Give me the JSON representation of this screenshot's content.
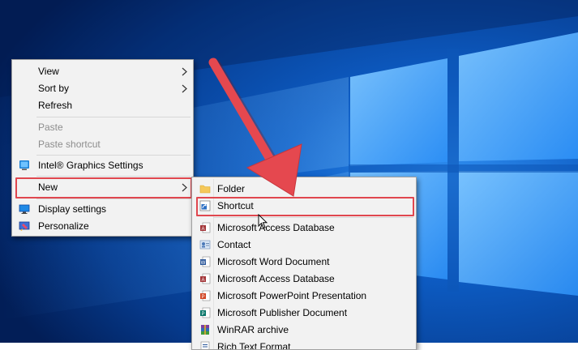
{
  "context_menu": {
    "items": [
      {
        "label": "View",
        "has_submenu": true
      },
      {
        "label": "Sort by",
        "has_submenu": true
      },
      {
        "label": "Refresh"
      },
      {
        "label": "Paste",
        "disabled": true
      },
      {
        "label": "Paste shortcut",
        "disabled": true
      },
      {
        "label": "Intel® Graphics Settings",
        "icon": "intel-graphics-icon"
      },
      {
        "label": "New",
        "has_submenu": true,
        "highlighted": true
      },
      {
        "label": "Display settings",
        "icon": "display-settings-icon"
      },
      {
        "label": "Personalize",
        "icon": "personalize-icon"
      }
    ]
  },
  "new_submenu": {
    "items": [
      {
        "label": "Folder",
        "icon": "folder-icon"
      },
      {
        "label": "Shortcut",
        "icon": "shortcut-icon",
        "highlighted": true
      },
      {
        "label": "Microsoft Access Database",
        "icon": "access-database-icon"
      },
      {
        "label": "Contact",
        "icon": "contact-icon"
      },
      {
        "label": "Microsoft Word Document",
        "icon": "word-document-icon"
      },
      {
        "label": "Microsoft Access Database",
        "icon": "access-database-icon"
      },
      {
        "label": "Microsoft PowerPoint Presentation",
        "icon": "powerpoint-icon"
      },
      {
        "label": "Microsoft Publisher Document",
        "icon": "publisher-icon"
      },
      {
        "label": "WinRAR archive",
        "icon": "winrar-icon"
      },
      {
        "label": "Rich Text Format",
        "icon": "rich-text-icon"
      }
    ]
  },
  "colors": {
    "desktop_blue": "#0a4fa8",
    "menu_background": "#f2f2f2",
    "highlight_red": "#e0474f",
    "arrow_red": "#e5484f"
  }
}
